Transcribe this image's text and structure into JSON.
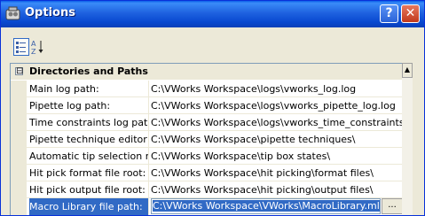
{
  "window": {
    "title": "Options",
    "help_glyph": "?",
    "close_glyph": "✕"
  },
  "toolbar": {
    "categorized_icon": "categorized-icon",
    "alphabetical_icon": "alphabetical-sort-icon"
  },
  "grid": {
    "category": {
      "label": "Directories and Paths",
      "expander": "⊟"
    },
    "rows": [
      {
        "name": "Main log path:",
        "value": "C:\\VWorks Workspace\\logs\\vworks_log.log"
      },
      {
        "name": "Pipette log path:",
        "value": "C:\\VWorks Workspace\\logs\\vworks_pipette_log.log"
      },
      {
        "name": "Time constraints log path:",
        "value": "C:\\VWorks Workspace\\logs\\vworks_time_constraints_log."
      },
      {
        "name": "Pipette technique editor roo",
        "value": "C:\\VWorks Workspace\\pipette techniques\\"
      },
      {
        "name": "Automatic tip selection root",
        "value": "C:\\VWorks Workspace\\tip box states\\"
      },
      {
        "name": "Hit pick format file root:",
        "value": "C:\\VWorks Workspace\\hit picking\\format files\\"
      },
      {
        "name": "Hit pick output file root:",
        "value": "C:\\VWorks Workspace\\hit picking\\output files\\"
      }
    ],
    "selected_row": {
      "name": "Macro Library file path:",
      "value": "C:\\VWorks Workspace\\VWorks\\MacroLibrary.mlb",
      "browse_label": "..."
    }
  },
  "scrollbar": {
    "up_glyph": "▲"
  },
  "colors": {
    "selection": "#316ac5",
    "titlebar": "#0a5ee8",
    "face": "#ece9d8"
  }
}
